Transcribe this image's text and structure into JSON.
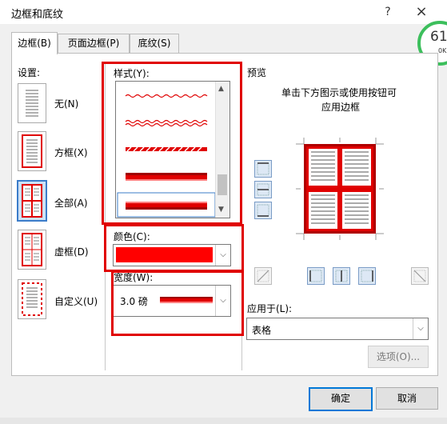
{
  "window": {
    "title": "边框和底纹",
    "help_icon": "?",
    "close_icon": "×"
  },
  "tabs": [
    {
      "label": "边框(B)",
      "active": true
    },
    {
      "label": "页面边框(P)",
      "active": false
    },
    {
      "label": "底纹(S)",
      "active": false
    }
  ],
  "settings": {
    "label": "设置:",
    "items": [
      {
        "label": "无(N)"
      },
      {
        "label": "方框(X)"
      },
      {
        "label": "全部(A)",
        "selected": true
      },
      {
        "label": "虚框(D)"
      },
      {
        "label": "自定义(U)"
      }
    ]
  },
  "style": {
    "label": "样式(Y):"
  },
  "color": {
    "label": "颜色(C):",
    "value_color": "#ff0000"
  },
  "width": {
    "label": "宽度(W):",
    "value": "3.0 磅"
  },
  "preview": {
    "label": "预览",
    "hint_line1": "单击下方图示或使用按钮可",
    "hint_line2": "应用边框"
  },
  "apply_to": {
    "label": "应用于(L):",
    "value": "表格"
  },
  "options_button": "选项(O)...",
  "ok_button": "确定",
  "cancel_button": "取消",
  "badge": {
    "number": "61",
    "sub": "0K"
  },
  "colors": {
    "accent_red": "#e00000",
    "border_dark_red": "#b00000",
    "select_blue": "#3b7cc9"
  }
}
